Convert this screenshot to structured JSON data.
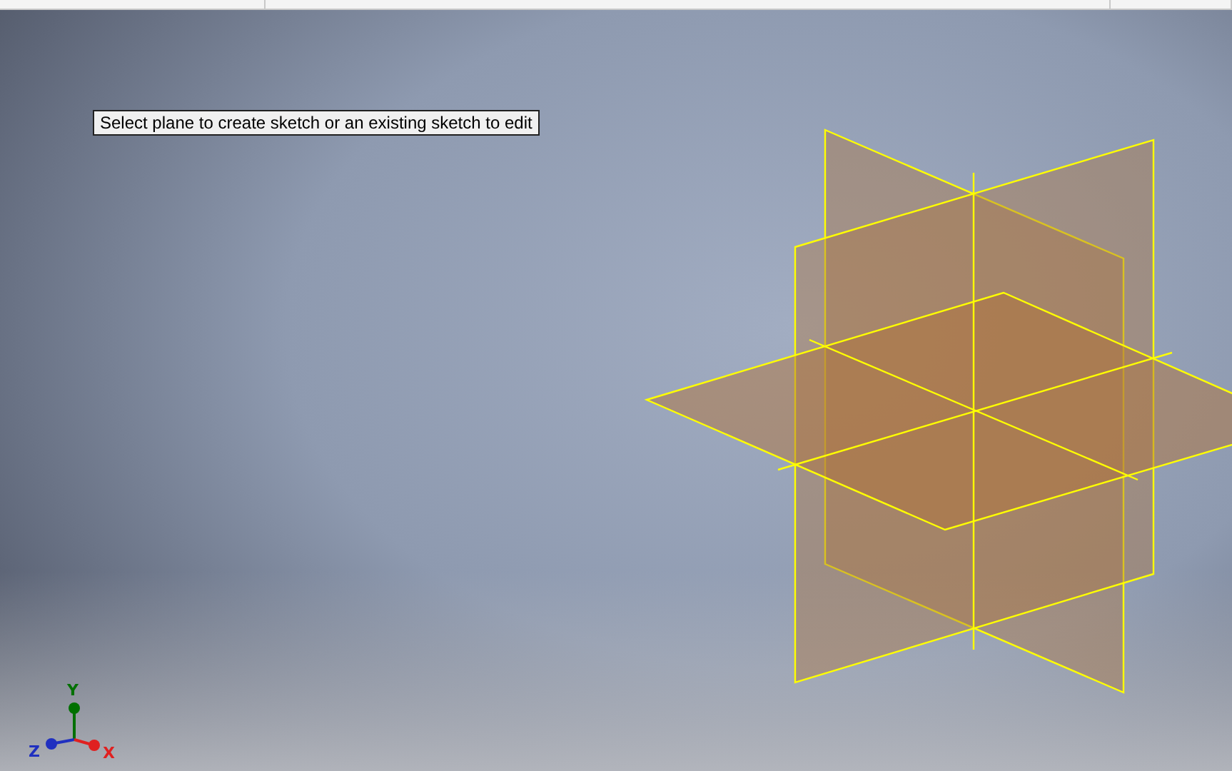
{
  "tooltip": {
    "text": "Select plane to create sketch or an existing sketch to edit"
  },
  "axis_triad": {
    "axes": [
      {
        "kind": "y",
        "label": "Y",
        "color": "#007000"
      },
      {
        "kind": "z",
        "label": "Z",
        "color": "#2030c0"
      },
      {
        "kind": "x",
        "label": "X",
        "color": "#e02020"
      }
    ]
  }
}
